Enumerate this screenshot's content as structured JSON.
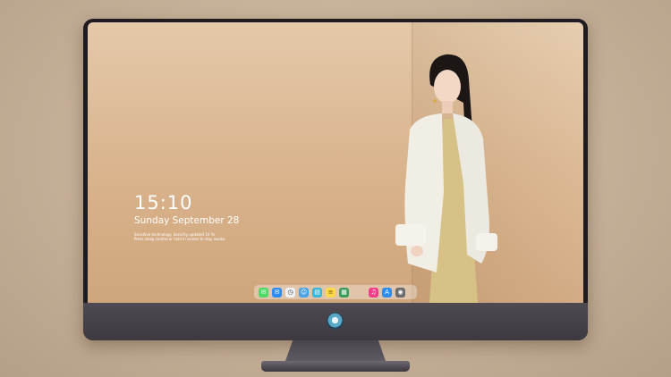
{
  "lock_screen": {
    "time": "15:10",
    "date": "Sunday September 28",
    "notice_line1": "Sensitive technology. Security updated 10 Yo",
    "notice_line2": "Press sleep control or hold in screen to stay awake"
  },
  "dock": {
    "icons": [
      {
        "name": "messages-icon",
        "color": "#4cd964",
        "glyph": "✉"
      },
      {
        "name": "mail-icon",
        "color": "#2f8cf0",
        "glyph": "✉"
      },
      {
        "name": "clock-icon",
        "color": "#f2f2f2",
        "glyph": "◷"
      },
      {
        "name": "finder-icon",
        "color": "#4aa3e8",
        "glyph": "☺"
      },
      {
        "name": "clapper-icon",
        "color": "#38b6d8",
        "glyph": "▤"
      },
      {
        "name": "notes-icon",
        "color": "#ffd84a",
        "glyph": "≡"
      },
      {
        "name": "photos-icon",
        "color": "#3a9b5a",
        "glyph": "▦"
      },
      {
        "name": "music-icon",
        "color": "#f23d8a",
        "glyph": "♫"
      },
      {
        "name": "app-store-icon",
        "color": "#2d8cf0",
        "glyph": "A"
      },
      {
        "name": "camera-icon",
        "color": "#6b6b6b",
        "glyph": "◉"
      }
    ]
  }
}
